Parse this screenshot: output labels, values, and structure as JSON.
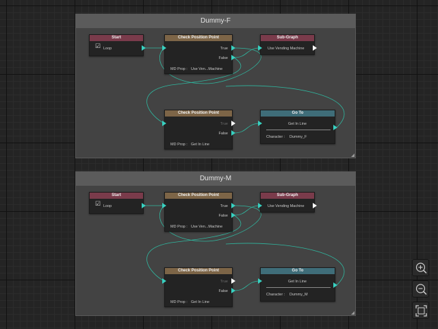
{
  "groups": [
    {
      "title": "Dummy-F",
      "start": {
        "header": "Start",
        "loop_label": "Loop",
        "checked": "☑"
      },
      "check1": {
        "header": "Check Position Point",
        "true_label": "True",
        "false_label": "False",
        "prop_label": "MD Prop :",
        "prop_value": "Use Ven...Machine"
      },
      "subgraph": {
        "header": "Sub-Graph",
        "target": "Use Vending Machine"
      },
      "check2": {
        "header": "Check Position Point",
        "true_label": "True",
        "false_label": "False",
        "prop_label": "MD Prop :",
        "prop_value": "Get In Line"
      },
      "goto": {
        "header": "Go To",
        "target": "Get In Line",
        "character_label": "Character :",
        "character_value": "Dummy_F"
      }
    },
    {
      "title": "Dummy-M",
      "start": {
        "header": "Start",
        "loop_label": "Loop",
        "checked": "☑"
      },
      "check1": {
        "header": "Check Position Point",
        "true_label": "True",
        "false_label": "False",
        "prop_label": "MD Prop :",
        "prop_value": "Use Ven...Machine"
      },
      "subgraph": {
        "header": "Sub-Graph",
        "target": "Use Vending Machine"
      },
      "check2": {
        "header": "Check Position Point",
        "true_label": "True",
        "false_label": "False",
        "prop_label": "MD Prop :",
        "prop_value": "Get In Line"
      },
      "goto": {
        "header": "Go To",
        "target": "Get In Line",
        "character_label": "Character :",
        "character_value": "Dummy_M"
      }
    }
  ],
  "toolbar": {
    "zoom_in_icon": "zoom-in-icon",
    "zoom_out_icon": "zoom-out-icon",
    "fit_icon": "fit-to-screen-icon"
  },
  "colors": {
    "wire": "#2fb8a0",
    "port": "#38d0c0",
    "start_header": "#7a3b4b",
    "check_header": "#7d6547",
    "goto_header": "#3f6d79"
  }
}
